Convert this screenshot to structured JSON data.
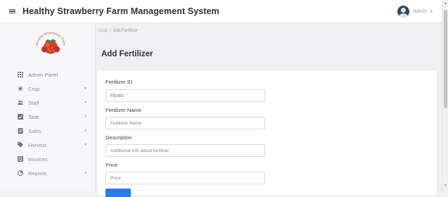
{
  "header": {
    "title": "Healthy Strawberry Farm Management System",
    "user_name": "Admin",
    "menu_icon": "hamburger-icon",
    "user_icon": "user-avatar-icon",
    "caret_icon": "chevron-down-icon"
  },
  "sidebar": {
    "logo_icon": "strawberry-logo",
    "logo_text": "Healthy Strawberry Farm",
    "items": [
      {
        "label": "Admin Panel",
        "icon": "grid-icon",
        "has_caret": false
      },
      {
        "label": "Crop",
        "icon": "sun-icon",
        "has_caret": true
      },
      {
        "label": "Staff",
        "icon": "users-icon",
        "has_caret": true
      },
      {
        "label": "Task",
        "icon": "checkbox-icon",
        "has_caret": true
      },
      {
        "label": "Sales",
        "icon": "receipt-icon",
        "has_caret": true
      },
      {
        "label": "Harvest",
        "icon": "tag-icon",
        "has_caret": true
      },
      {
        "label": "Invoices",
        "icon": "invoice-icon",
        "has_caret": false
      },
      {
        "label": "Reports",
        "icon": "pie-chart-icon",
        "has_caret": true
      }
    ]
  },
  "breadcrumb": {
    "parent": "Crop",
    "separator": "/",
    "current": "Add Fertilizer"
  },
  "page": {
    "title": "Add Fertilizer"
  },
  "form": {
    "fields": [
      {
        "label": "Fertilizer ID",
        "value": "FE001",
        "placeholder": ""
      },
      {
        "label": "Fertilizer Name",
        "value": "",
        "placeholder": "Fertilizer Name"
      },
      {
        "label": "Description",
        "value": "",
        "placeholder": "Additional info about fertilizer"
      },
      {
        "label": "Price",
        "value": "",
        "placeholder": "Price"
      }
    ]
  },
  "colors": {
    "accent": "#2a7be4",
    "sidebar_bg": "#f6f7f8",
    "page_bg": "#eef0f2"
  }
}
